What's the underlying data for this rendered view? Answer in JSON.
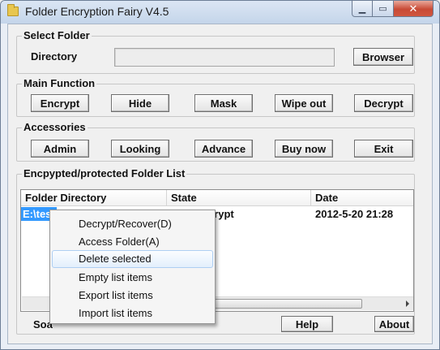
{
  "window": {
    "title": "Folder Encryption Fairy V4.5",
    "minimize_glyph": "▁",
    "maximize_glyph": "▭",
    "close_glyph": "✕"
  },
  "select_folder": {
    "title": "Select Folder",
    "directory_label": "Directory",
    "directory_value": "",
    "browser_label": "Browser"
  },
  "main_function": {
    "title": "Main Function",
    "buttons": [
      "Encrypt",
      "Hide",
      "Mask",
      "Wipe out",
      "Decrypt"
    ]
  },
  "accessories": {
    "title": "Accessories",
    "buttons": [
      "Admin",
      "Looking",
      "Advance",
      "Buy now",
      "Exit"
    ]
  },
  "folder_list": {
    "title": "Encpypted/protected Folder List",
    "columns": [
      "Folder Directory",
      "State",
      "Date"
    ],
    "rows": [
      {
        "directory": "E:\\test",
        "state": "Fast Encrypt",
        "date": "2012-5-20 21:28"
      }
    ]
  },
  "context_menu": {
    "items": [
      "Decrypt/Recover(D)",
      "Access Folder(A)",
      "Delete selected",
      "Empty list items",
      "Export list items",
      "Import list items"
    ],
    "highlighted_index": 2
  },
  "footer": {
    "left_text": "Soa",
    "help_label": "Help",
    "about_label": "About"
  }
}
